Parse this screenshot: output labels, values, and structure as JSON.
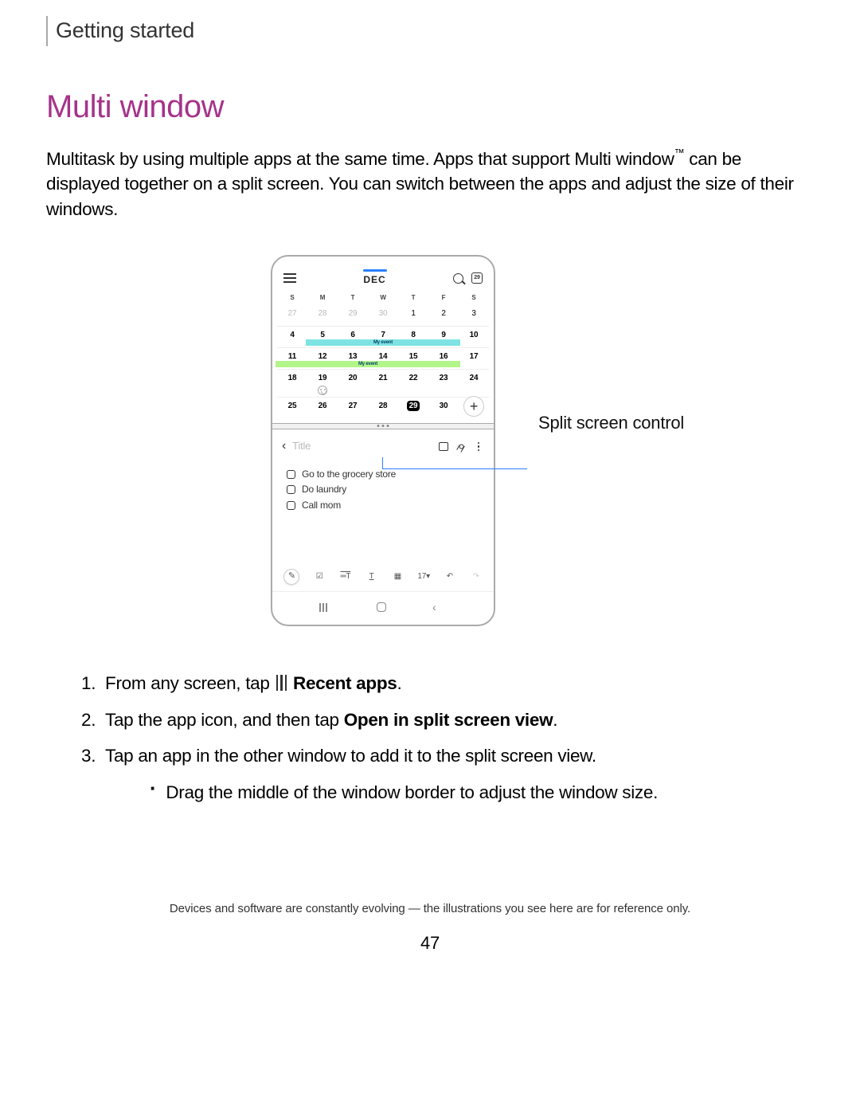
{
  "header": "Getting started",
  "title": "Multi window",
  "intro_1": "Multitask by using multiple apps at the same time. Apps that support Multi window",
  "intro_tm": "™",
  "intro_2": " can be displayed together on a split screen. You can switch between the apps and adjust the size of their windows.",
  "callout": "Split screen control",
  "calendar": {
    "month": "DEC",
    "today_badge": "29",
    "day_headers": [
      "S",
      "M",
      "T",
      "W",
      "T",
      "F",
      "S"
    ],
    "rows": [
      [
        {
          "d": "27",
          "dim": true
        },
        {
          "d": "28",
          "dim": true
        },
        {
          "d": "29",
          "dim": true
        },
        {
          "d": "30",
          "dim": true
        },
        {
          "d": "1"
        },
        {
          "d": "2"
        },
        {
          "d": "3"
        }
      ],
      [
        {
          "d": "4",
          "bold": true
        },
        {
          "d": "5",
          "bold": true
        },
        {
          "d": "6",
          "bold": true
        },
        {
          "d": "7",
          "bold": true
        },
        {
          "d": "8",
          "bold": true
        },
        {
          "d": "9",
          "bold": true
        },
        {
          "d": "10",
          "bold": true
        }
      ],
      [
        {
          "d": "11",
          "bold": true
        },
        {
          "d": "12",
          "bold": true
        },
        {
          "d": "13",
          "bold": true
        },
        {
          "d": "14",
          "bold": true
        },
        {
          "d": "15",
          "bold": true
        },
        {
          "d": "16",
          "bold": true
        },
        {
          "d": "17",
          "bold": true
        }
      ],
      [
        {
          "d": "18",
          "bold": true
        },
        {
          "d": "19",
          "bold": true,
          "smile": true
        },
        {
          "d": "20",
          "bold": true
        },
        {
          "d": "21",
          "bold": true
        },
        {
          "d": "22",
          "bold": true
        },
        {
          "d": "23",
          "bold": true
        },
        {
          "d": "24",
          "bold": true
        }
      ],
      [
        {
          "d": "25",
          "bold": true
        },
        {
          "d": "26",
          "bold": true
        },
        {
          "d": "27",
          "bold": true
        },
        {
          "d": "28",
          "bold": true
        },
        {
          "d": "29",
          "bold": true,
          "today": true
        },
        {
          "d": "30",
          "bold": true
        },
        {
          "d": ""
        }
      ]
    ],
    "event1": "My event",
    "event2": "My event"
  },
  "notes": {
    "title_placeholder": "Title",
    "items": [
      "Go to the grocery store",
      "Do laundry",
      "Call mom"
    ],
    "font_size": "17"
  },
  "steps": {
    "s1_a": "From any screen, tap",
    "s1_b": "Recent apps",
    "s1_c": ".",
    "s2_a": "Tap the app icon, and then tap ",
    "s2_b": "Open in split screen view",
    "s2_c": ".",
    "s3": "Tap an app in the other window to add it to the split screen view.",
    "s3_sub": "Drag the middle of the window border to adjust the window size."
  },
  "footnote": "Devices and software are constantly evolving — the illustrations you see here are for reference only.",
  "page_number": "47"
}
